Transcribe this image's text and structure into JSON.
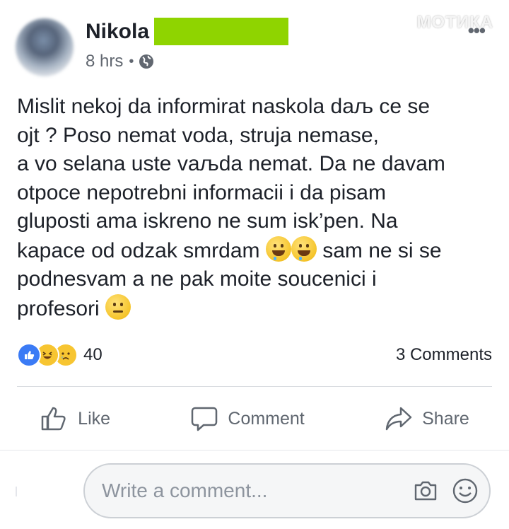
{
  "watermark": "МОТИКА",
  "post": {
    "author": "Nikola",
    "time": "8 hrs",
    "privacy_icon": "globe-icon",
    "more_icon": "more-dots-icon",
    "text_lines": [
      "Mislit nekoj da informirat naskola daљ ce se",
      "ojt ? Poso nemat voda, struja nemase,",
      "a vo selana uste vaљda nemat. Da ne davam",
      "otpoce nepotrebni informacii i da pisam",
      "gluposti ama iskreno ne sum isk’pen. Na"
    ],
    "line6_text": "kapace od odzak smrdam",
    "line6_after": "sam ne si se",
    "line7": "podnesvam a ne pak moite soucenici i",
    "line8": "profesori",
    "emojis": [
      "drooling-face",
      "drooling-face",
      "neutral-face"
    ]
  },
  "reactions": {
    "icons": [
      "like-icon",
      "haha-icon",
      "sad-icon"
    ],
    "count": "40",
    "comments": "3 Comments"
  },
  "actions": {
    "like": "Like",
    "comment": "Comment",
    "share": "Share"
  },
  "comment_bar": {
    "placeholder": "Write a comment..."
  },
  "colors": {
    "name_highlight": "#8fd400",
    "like_blue": "#3b7bf5",
    "text": "#1d2129",
    "muted": "#616770"
  }
}
